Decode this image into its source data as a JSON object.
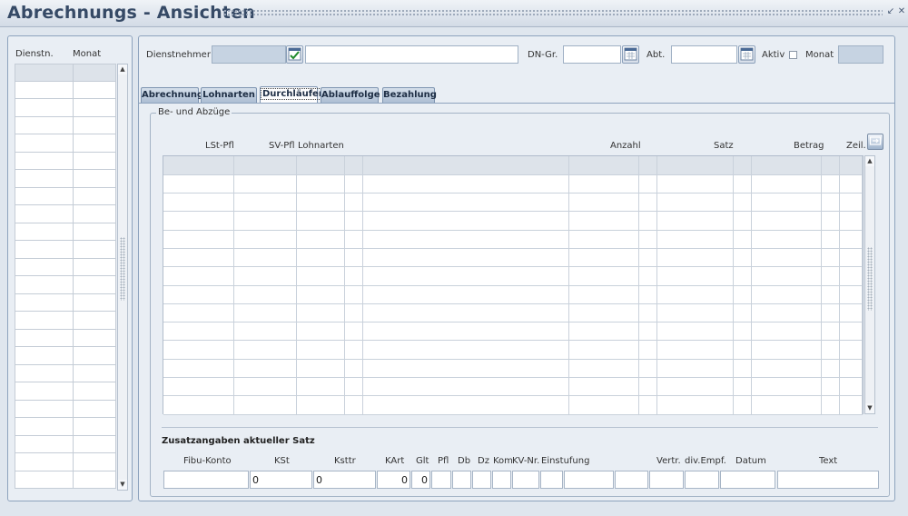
{
  "window": {
    "title": "Abrechnungs - Ansichten",
    "controls": [
      "minimize-icon",
      "close-icon"
    ]
  },
  "left_panel": {
    "columns": [
      "Dienstn.",
      "Monat"
    ],
    "row_count": 24
  },
  "header": {
    "dienstnehmer_label": "Dienstnehmer",
    "dienstnehmer_id": "",
    "dienstnehmer_name": "",
    "dn_gr_label": "DN-Gr.",
    "dn_gr_value": "",
    "abt_label": "Abt.",
    "abt_value": "",
    "aktiv_label": "Aktiv",
    "aktiv_checked": false,
    "monat_label": "Monat",
    "monat_value": ""
  },
  "tabs": [
    {
      "label": "Abrechnung",
      "active": false
    },
    {
      "label": "Lohnarten",
      "active": false
    },
    {
      "label": "Durchläufer",
      "active": true
    },
    {
      "label": "Ablauffolge",
      "active": false
    },
    {
      "label": "Bezahlung",
      "active": false
    }
  ],
  "section": {
    "title": "Be- und Abzüge",
    "columns": [
      "LSt-Pfl",
      "SV-Pfl",
      "Lohnarten",
      "Anzahl",
      "Satz",
      "Betrag",
      "Zeil."
    ],
    "row_count": 14
  },
  "details": {
    "title": "Zusatzangaben aktueller Satz",
    "columns": [
      "Fibu-Konto",
      "KSt",
      "Ksttr",
      "KArt",
      "Glt",
      "Pfl",
      "Db",
      "Dz",
      "Kom",
      "KV-Nr.",
      "Einstufung",
      "Vertr.",
      "div.Empf.",
      "Datum",
      "Text"
    ],
    "values": {
      "fibu_konto": "",
      "kst": "0",
      "ksttr": "0",
      "kart": "0",
      "glt": "0"
    }
  },
  "colors": {
    "accent": "#364a66",
    "panel": "#e9eef4",
    "readonly_field": "#c6d3e2"
  }
}
